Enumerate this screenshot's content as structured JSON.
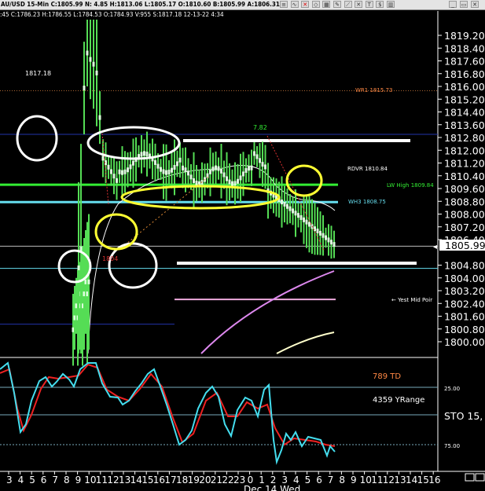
{
  "header": {
    "title": "AU/USD  15-Min  C:1805.99  N:  4.85  H:1813.06  L:1805.17  O:1810.60  B:1805.99  A:1806.31  V:",
    "subline": ":45  C:1786.23  H:1786.55  L:1784.53  O:1784.93  V:955  S:1817.18  12-13-22  4:34",
    "toolbar_icons": [
      "lines-icon",
      "wave-icon",
      "close-red-icon",
      "indicator-icon",
      "grid-icon",
      "pencil-icon",
      "ruler-icon",
      "cross-icon",
      "text-icon",
      "dollar-icon",
      "chart-icon",
      "minimize-icon",
      "restore-icon",
      "close-icon"
    ]
  },
  "price_axis": {
    "ticks": [
      "1819.20",
      "1818.40",
      "1817.60",
      "1816.80",
      "1816.00",
      "1815.20",
      "1814.40",
      "1813.60",
      "1812.80",
      "1812.00",
      "1811.20",
      "1810.40",
      "1809.60",
      "1808.80",
      "1808.00",
      "1807.20",
      "1806.40",
      "1804.80",
      "1804.00",
      "1803.20",
      "1802.40",
      "1801.60",
      "1800.80",
      "1800.00"
    ],
    "current": "1805.99"
  },
  "annotations": {
    "high_label": "1817.18",
    "wr1": "WR1  1815.73",
    "rdvr": "RDVR  1810.84",
    "lw_high": "LW High  1809.84",
    "wh3": "WH3  1808.75",
    "yest_mid": "← Yest Mid Poir",
    "peak": "7.82",
    "low": "1804"
  },
  "oscillator": {
    "td": "789 TD",
    "yrange": "4359 YRange",
    "sto": "STO  15,",
    "levels": [
      "25.00",
      "75.00"
    ]
  },
  "x_axis": {
    "ticks": [
      "3",
      "4",
      "5",
      "6",
      "7",
      "8",
      "9",
      "10",
      "11",
      "12",
      "13",
      "14",
      "15",
      "16",
      "17",
      "18",
      "19",
      "20",
      "21",
      "22",
      "23",
      "0",
      "1",
      "2",
      "3",
      "4",
      "5",
      "6",
      "7",
      "8",
      "9",
      "10",
      "11",
      "12",
      "13",
      "14",
      "15",
      "16"
    ],
    "date_label": "Dec 14 Wed"
  },
  "colors": {
    "bar": "#55dd55",
    "white_line": "#ffffff",
    "yellow": "#ffff33",
    "green_line": "#33ee33",
    "cyan_line": "#66ddee",
    "blue_line": "#2233aa",
    "pink_line": "#eeaadd",
    "violet_curve": "#dd88ee",
    "stoch_red": "#ee2222",
    "stoch_cyan": "#44ddee",
    "td_text": "#ff8844",
    "orange": "#ff8844"
  }
}
